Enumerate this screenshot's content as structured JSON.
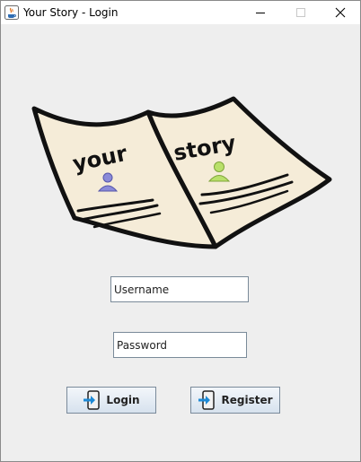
{
  "window": {
    "title": "Your Story - Login"
  },
  "hero": {
    "word_left": "your",
    "word_right": "story"
  },
  "form": {
    "username_value": "Username",
    "password_value": "Password",
    "login_label": "Login",
    "register_label": "Register"
  }
}
